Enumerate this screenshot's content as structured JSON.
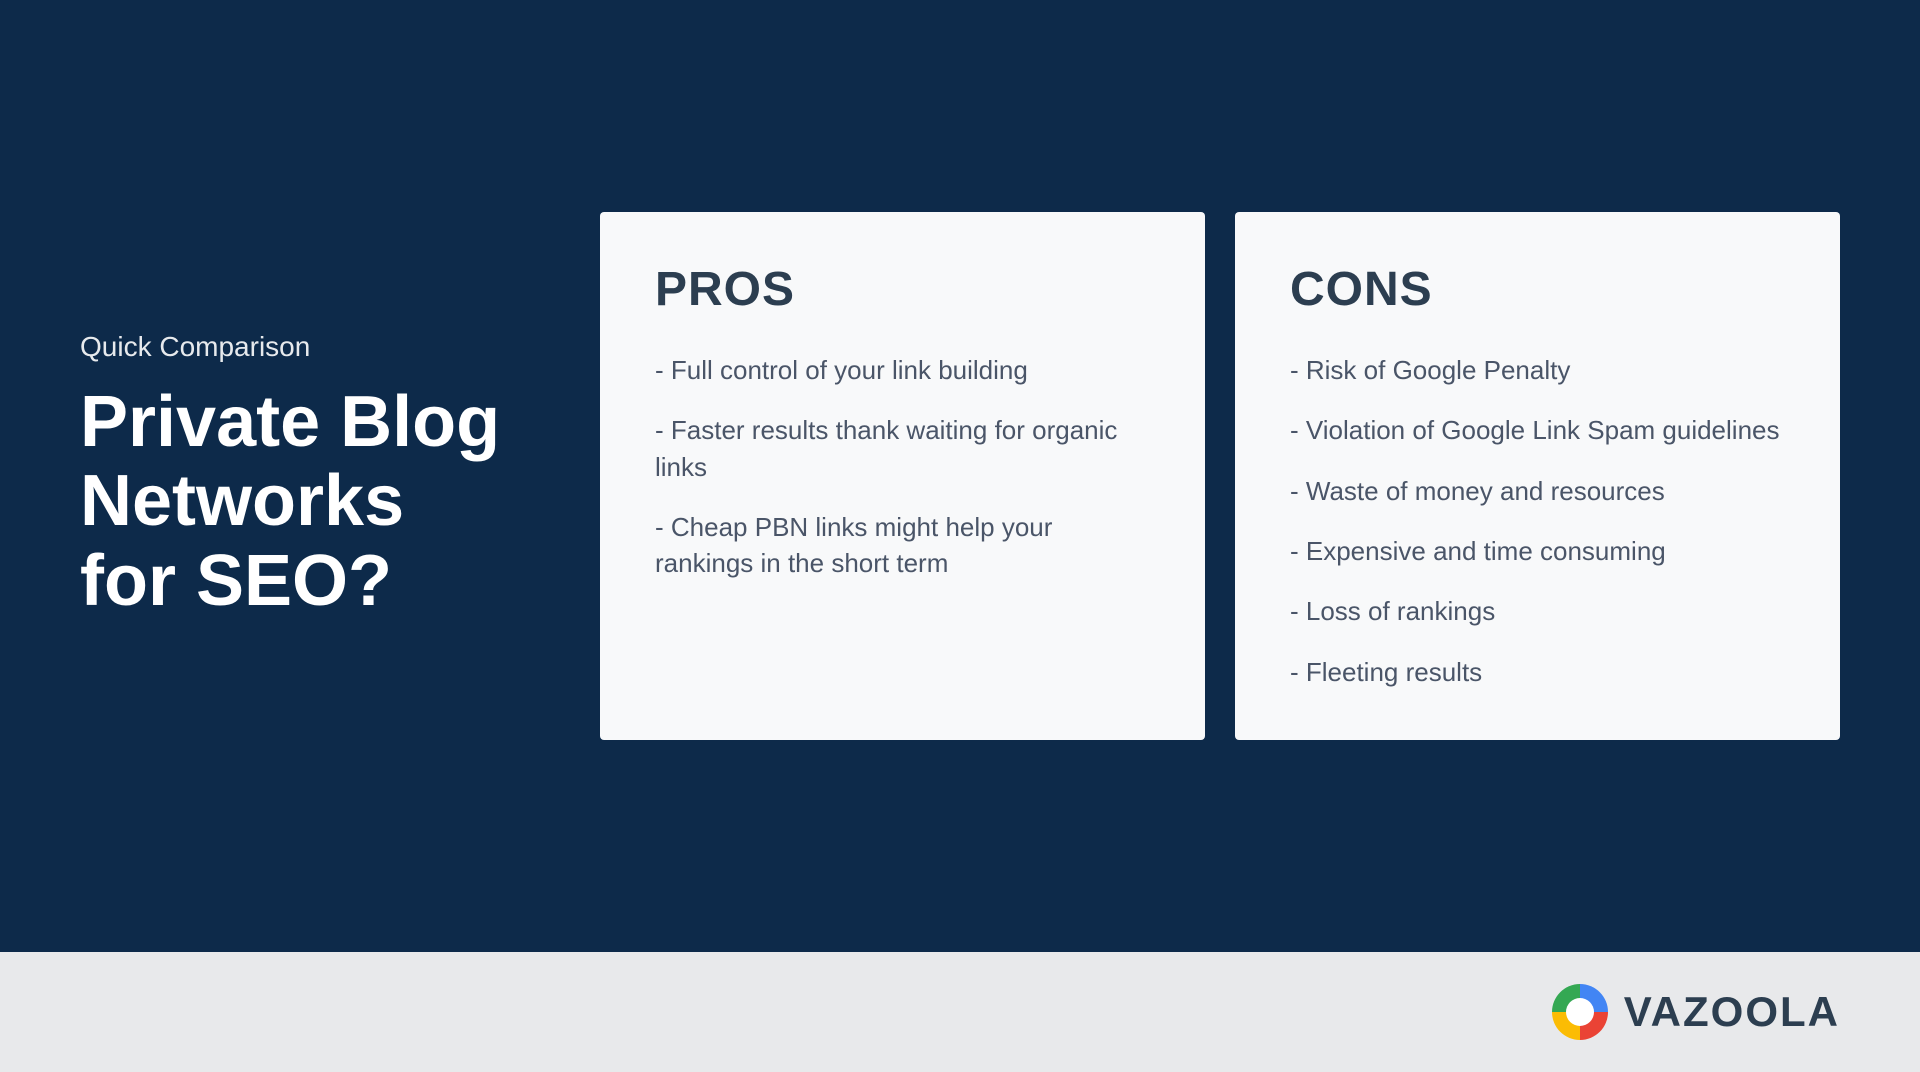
{
  "left": {
    "quick_comparison": "Quick Comparison",
    "title_line1": "Private Blog",
    "title_line2": "Networks",
    "title_line3": "for SEO?"
  },
  "pros_card": {
    "title": "PROS",
    "items": [
      "- Full control of your link building",
      "- Faster results thank waiting for organic links",
      "- Cheap PBN links might help your rankings in the short term"
    ]
  },
  "cons_card": {
    "title": "CONS",
    "items": [
      "- Risk of Google Penalty",
      "- Violation of Google Link Spam guidelines",
      "- Waste of money and resources",
      "- Expensive and time consuming",
      "- Loss of rankings",
      "- Fleeting results"
    ]
  },
  "footer": {
    "logo_text": "VAZOOLA"
  },
  "colors": {
    "background": "#0d2a4a",
    "card_bg": "#f8f9fa",
    "footer_bg": "#e8e9eb"
  }
}
